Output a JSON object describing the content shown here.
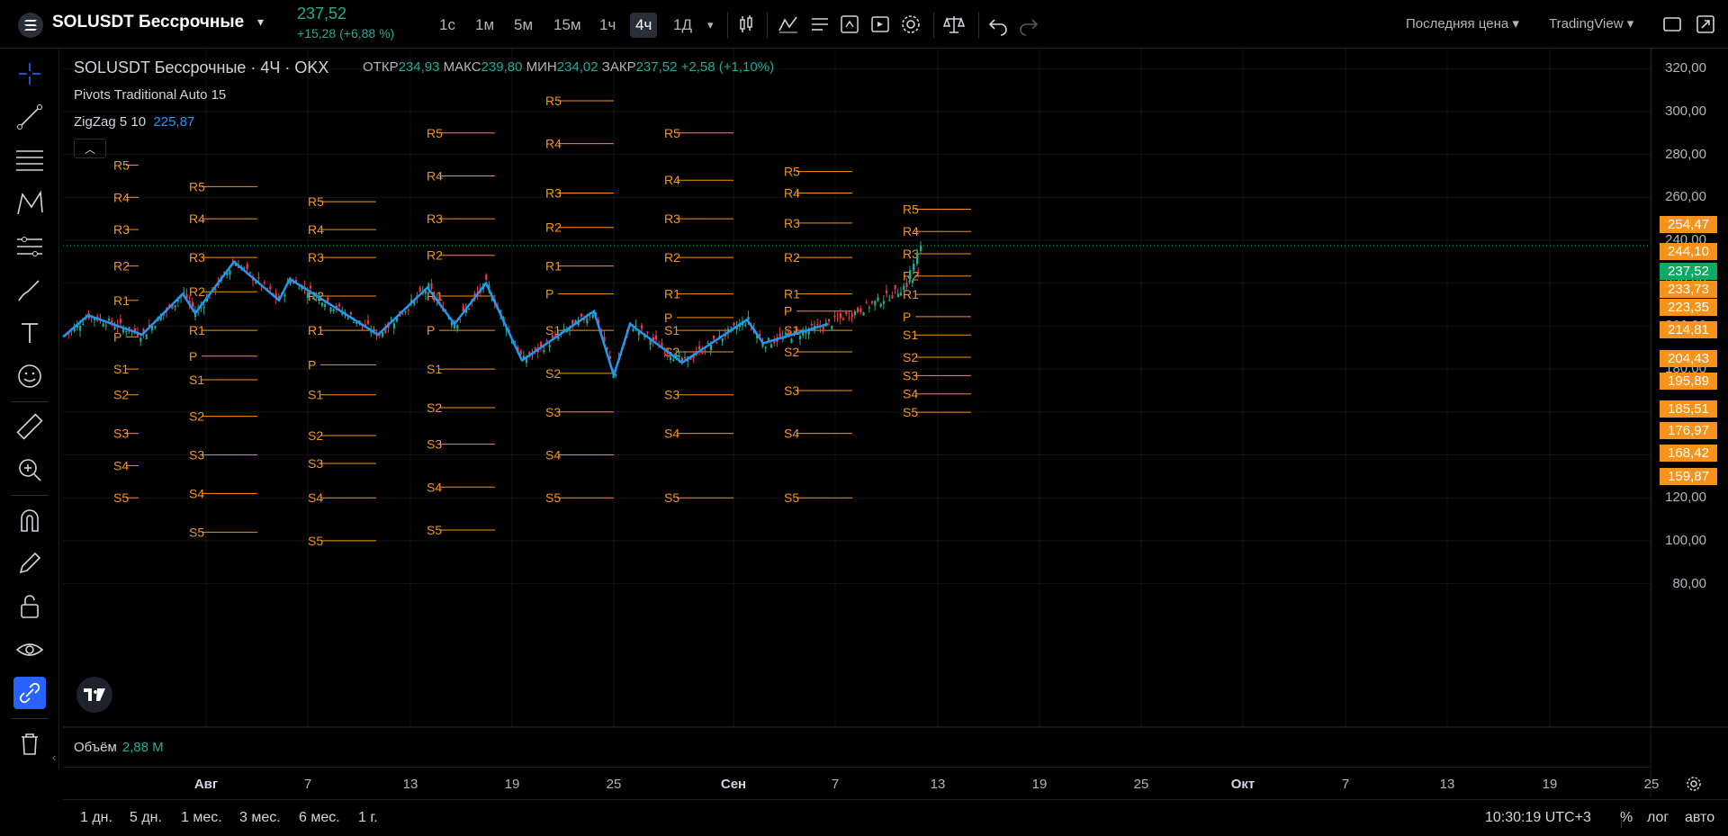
{
  "header": {
    "symbol": "SOLUSDT Бессрочные",
    "last_price": "237,52",
    "change": "+15,28 (+6,88 %)",
    "timeframes": [
      "1с",
      "1м",
      "5м",
      "15м",
      "1ч",
      "4ч",
      "1Д"
    ],
    "active_timeframe": "4ч",
    "price_mode": "Последняя цена",
    "brand": "TradingView"
  },
  "legend": {
    "title": "SOLUSDT Бессрочные · 4Ч · OKX",
    "open_k": "ОТКР",
    "open_v": "234,93",
    "high_k": "МАКС",
    "high_v": "239,80",
    "low_k": "МИН",
    "low_v": "234,02",
    "close_k": "ЗАКР",
    "close_v": "237,52",
    "delta": "+2,58 (+1,10%)",
    "ind1": "Pivots Traditional Auto 15",
    "ind2_name": "ZigZag 5 10",
    "ind2_value": "225,87",
    "volume_name": "Объём",
    "volume_value": "2,88 M"
  },
  "price_axis": {
    "labels": [
      "320,00",
      "300,00",
      "280,00",
      "260,00",
      "240,00",
      "220,00",
      "200,00",
      "180,00",
      "160,00",
      "140,00",
      "120,00",
      "100,00",
      "80,00"
    ],
    "tags": [
      {
        "value": "254,47",
        "color": "#f7931a"
      },
      {
        "value": "244,10",
        "color": "#f7931a"
      },
      {
        "value": "237,52",
        "color": "#0bab64"
      },
      {
        "value": "233,73",
        "color": "#f7931a"
      },
      {
        "value": "223,35",
        "color": "#f7931a"
      },
      {
        "value": "214,81",
        "color": "#f7931a"
      },
      {
        "value": "204,43",
        "color": "#f7931a"
      },
      {
        "value": "195,89",
        "color": "#f7931a"
      },
      {
        "value": "185,51",
        "color": "#f7931a"
      },
      {
        "value": "176,97",
        "color": "#f7931a"
      },
      {
        "value": "168,42",
        "color": "#f7931a"
      },
      {
        "value": "159,87",
        "color": "#f7931a"
      }
    ]
  },
  "time_axis": {
    "labels": [
      "Авг",
      "7",
      "13",
      "19",
      "25",
      "Сен",
      "7",
      "13",
      "19",
      "25",
      "Окт",
      "7",
      "13",
      "19",
      "25"
    ],
    "bold": [
      "Авг",
      "Сен",
      "Окт"
    ]
  },
  "pivot_levels": [
    "R5",
    "R4",
    "R3",
    "R2",
    "R1",
    "P",
    "S1",
    "S2",
    "S3",
    "S4",
    "S5"
  ],
  "bottom": {
    "ranges": [
      "1 дн.",
      "5 дн.",
      "1 мес.",
      "3 мес.",
      "6 мес.",
      "1 г."
    ],
    "clock": "10:30:19 UTC+3",
    "percent": "%",
    "log": "лог",
    "auto": "авто"
  },
  "colors": {
    "up": "#22ab94",
    "down": "#f23645",
    "pivot": "#f7931a",
    "zigzag": "#2196f3",
    "link_active": "#2962ff"
  }
}
